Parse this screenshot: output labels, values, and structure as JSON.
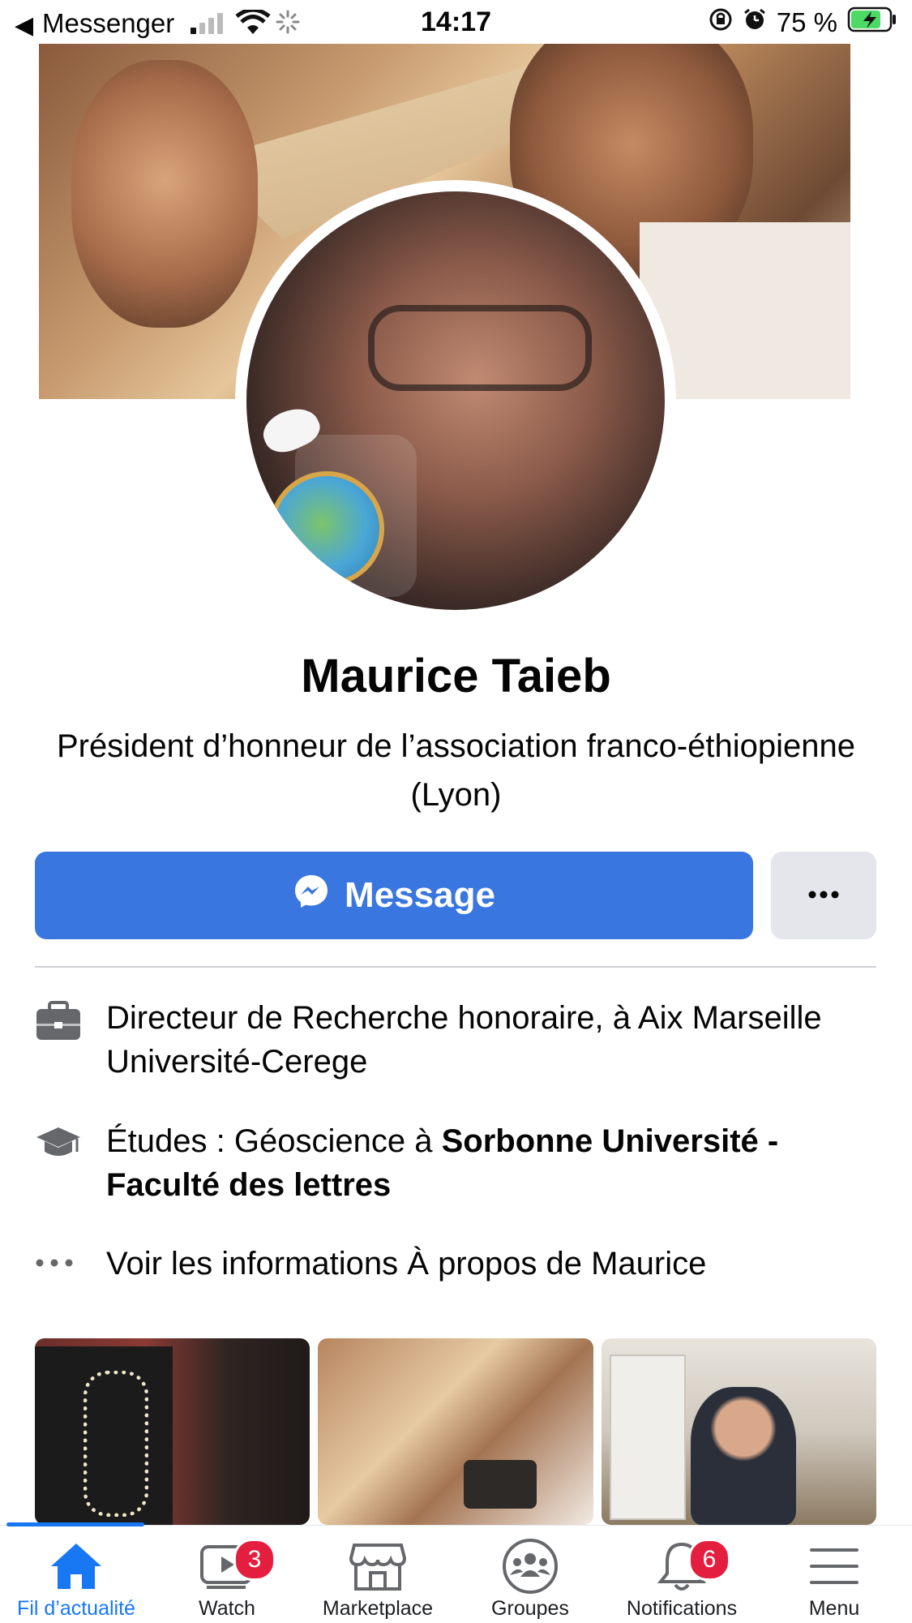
{
  "status_bar": {
    "back_app": "Messenger",
    "time": "14:17",
    "battery": "75 %"
  },
  "profile": {
    "name": "Maurice Taieb",
    "bio": "Président d’honneur de l’association franco-éthiopienne (Lyon)"
  },
  "actions": {
    "message_label": "Message",
    "more_label": "•••"
  },
  "info": {
    "work": "Directeur de Recherche honoraire, à Aix Marseille Université-Cerege",
    "education_prefix": "Études : Géoscience à ",
    "education_school": "Sorbonne Université - Faculté des lettres",
    "about_link": "Voir les informations À propos de Maurice"
  },
  "tabs": [
    {
      "label": "Fil d’actualité",
      "icon": "home-icon",
      "active": true
    },
    {
      "label": "Watch",
      "icon": "watch-icon",
      "badge": "3"
    },
    {
      "label": "Marketplace",
      "icon": "marketplace-icon"
    },
    {
      "label": "Groupes",
      "icon": "groups-icon"
    },
    {
      "label": "Notifications",
      "icon": "bell-icon",
      "badge": "6"
    },
    {
      "label": "Menu",
      "icon": "menu-icon"
    }
  ],
  "colors": {
    "accent": "#1877f2",
    "message_button": "#3a76e0",
    "badge": "#e41e3f",
    "battery": "#4cd964"
  }
}
